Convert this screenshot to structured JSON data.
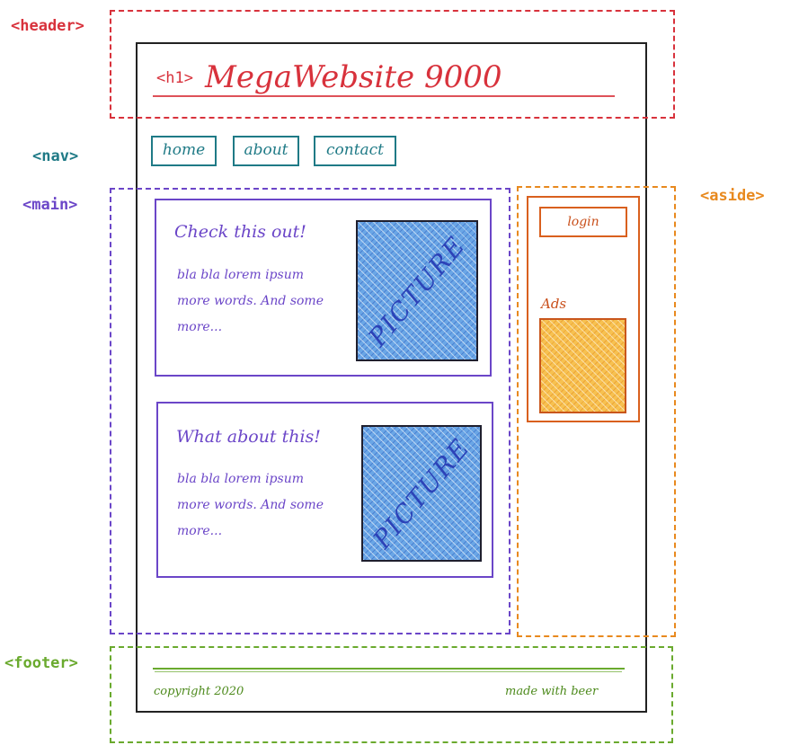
{
  "labels": {
    "header": "<header>",
    "nav": "<nav>",
    "main": "<main>",
    "aside": "<aside>",
    "footer": "<footer>"
  },
  "header": {
    "h1_tag": "<h1>",
    "title": "MegaWebsite 9000"
  },
  "nav": {
    "items": [
      "home",
      "about",
      "contact"
    ]
  },
  "main": {
    "articles": [
      {
        "title": "Check this out!",
        "lines": [
          "bla bla lorem ipsum",
          "more words. And some",
          "more..."
        ],
        "picture": "PICTURE"
      },
      {
        "title": "What about this!",
        "lines": [
          "bla bla lorem ipsum",
          "more words. And some",
          "more..."
        ],
        "picture": "PICTURE"
      }
    ]
  },
  "aside": {
    "login": "login",
    "ads_label": "Ads"
  },
  "footer": {
    "copyright": "copyright 2020",
    "made_with": "made with beer"
  },
  "colors": {
    "header": "#d8323c",
    "nav": "#1f7a86",
    "main": "#6b46c8",
    "aside": "#e8891e",
    "footer": "#6aaa2e",
    "page_border": "#222222"
  },
  "icons": {
    "picture": "picture-placeholder",
    "ad": "ad-placeholder"
  }
}
